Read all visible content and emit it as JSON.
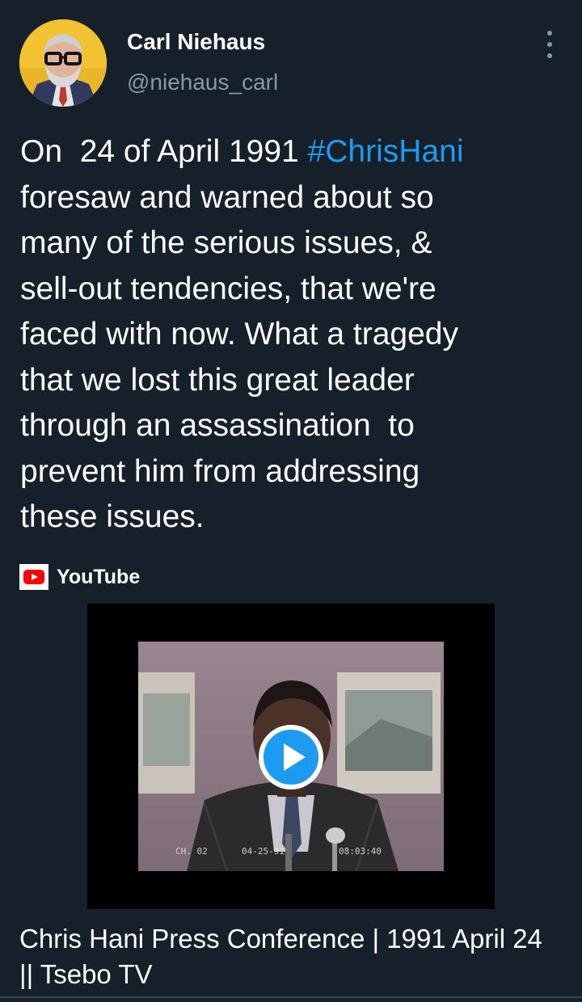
{
  "tweet": {
    "author": {
      "name": "Carl Niehaus",
      "handle": "@niehaus_carl"
    },
    "text_parts": [
      "On  24 of April 1991 ",
      "#ChrisHani",
      "\nforesaw and warned about so\nmany of the serious issues, &\nsell-out tendencies, that we're\nfaced with now. What a tragedy\nthat we lost this great leader\nthrough an assassination  to\nprevent him from addressing\nthese issues."
    ],
    "hashtag_color": "#1d9bf0"
  },
  "card": {
    "source": "YouTube",
    "title": "Chris Hani Press Conference | 1991 April 24 || Tsebo TV",
    "video_overlay": {
      "channel": "CH. 02",
      "date": "04-25-91",
      "time": "08:03:40"
    }
  },
  "icons": {
    "more": "more-vertical-icon",
    "youtube": "youtube-logo-icon",
    "play": "play-icon"
  },
  "colors": {
    "background": "#15202b",
    "secondary_text": "#8899a6",
    "accent": "#1d9bf0",
    "youtube_red": "#ff0000"
  }
}
